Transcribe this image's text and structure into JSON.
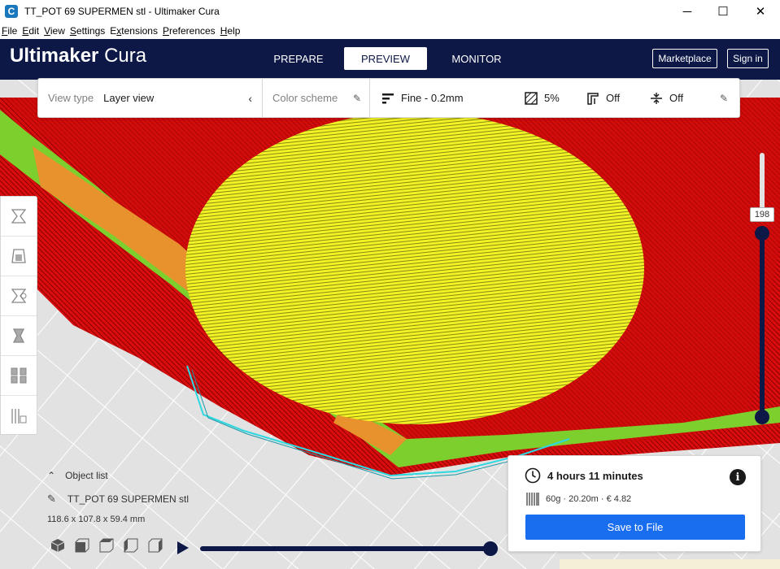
{
  "window": {
    "title": "TT_POT 69 SUPERMEN stl - Ultimaker Cura",
    "app_icon_letter": "C",
    "minimize_glyph": "─",
    "maximize_glyph": "☐",
    "close_glyph": "✕"
  },
  "menu": {
    "items": [
      {
        "key": "F",
        "rest": "ile"
      },
      {
        "key": "E",
        "rest": "dit"
      },
      {
        "key": "V",
        "rest": "iew"
      },
      {
        "key": "S",
        "rest": "ettings"
      },
      {
        "key": "x",
        "prefix": "E",
        "rest": "tensions"
      },
      {
        "key": "P",
        "rest": "references"
      },
      {
        "key": "H",
        "rest": "elp"
      }
    ]
  },
  "header": {
    "brand": "Ultimaker",
    "product": "Cura",
    "tabs": [
      "PREPARE",
      "PREVIEW",
      "MONITOR"
    ],
    "active_tab": "PREVIEW",
    "marketplace_label": "Marketplace",
    "signin_label": "Sign in",
    "bg_color": "#0d1847"
  },
  "view_toolbar": {
    "view_type_label": "View type",
    "view_type_value": "Layer view",
    "color_scheme_label": "Color scheme",
    "profile": "Fine - 0.2mm",
    "infill": "5%",
    "support": "Off",
    "adhesion": "Off"
  },
  "layer_slider": {
    "current_layer": "198"
  },
  "object": {
    "list_label": "Object list",
    "name": "TT_POT 69 SUPERMEN stl",
    "dimensions": "118.6 x 107.8 x 59.4 mm"
  },
  "print_info": {
    "time": "4 hours 11 minutes",
    "material": "60g · 20.20m · € 4.82",
    "save_label": "Save to File",
    "accent_color": "#196ef0"
  },
  "icons": {
    "pencil": "✎",
    "chevron_left": "‹",
    "chevron_up": "⌃",
    "info": "i"
  }
}
